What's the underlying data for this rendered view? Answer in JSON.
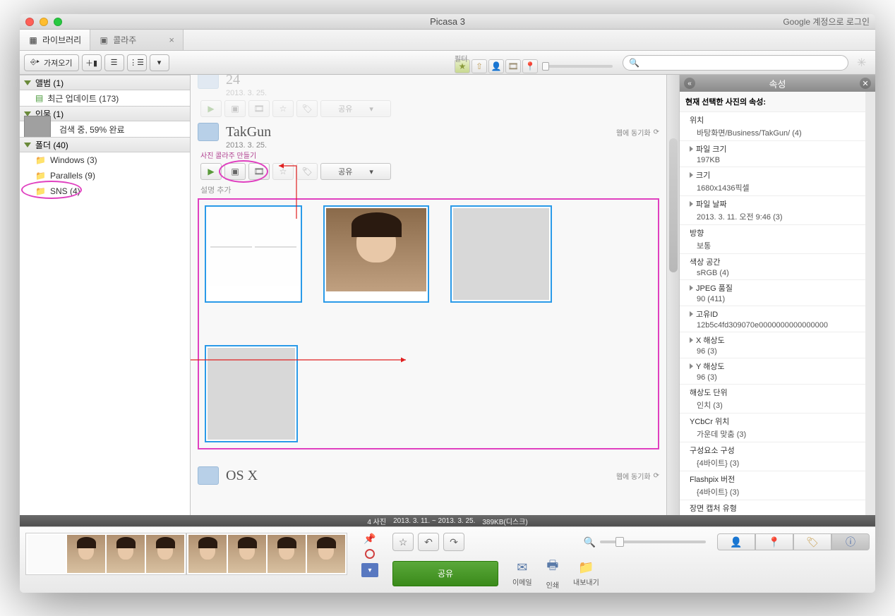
{
  "window": {
    "title": "Picasa 3",
    "login": "Google 계정으로 로그인"
  },
  "tabs": [
    {
      "label": "라이브러리",
      "active": true
    },
    {
      "label": "콜라주",
      "active": false,
      "closable": true
    }
  ],
  "toolbar": {
    "import": "가져오기",
    "filter_label": "필터"
  },
  "sidebar": {
    "albums": {
      "head": "앨범 (1)",
      "items": [
        {
          "label": "최근 업데이트 (173)"
        }
      ]
    },
    "people": {
      "head": "인물 (1)",
      "scan": "검색 중, 59% 완료"
    },
    "folders": {
      "head": "폴더 (40)",
      "items": [
        {
          "label": "Windows (3)"
        },
        {
          "label": "Parallels (9)"
        },
        {
          "label": "SNS (4)",
          "highlighted": true
        }
      ]
    }
  },
  "content": {
    "faded_album": {
      "title": "24",
      "date": "2013. 3. 25."
    },
    "main_album": {
      "title": "TakGun",
      "date": "2013. 3. 25.",
      "overlay_hint": "사진 콜라주 만들기",
      "share": "공유",
      "web_sync": "웹에 동기화",
      "add_desc": "설명 추가",
      "thumbs": [
        {
          "kind": "document"
        },
        {
          "kind": "portrait"
        },
        {
          "kind": "collage4"
        },
        {
          "kind": "collage4"
        }
      ]
    },
    "next_album": {
      "title": "OS X",
      "web_sync": "웹에 동기화"
    }
  },
  "properties": {
    "title": "속성",
    "selected_label": "현재 선택한 사진의 속성:",
    "rows": [
      {
        "k": "위치",
        "v": "바탕화면/Business/TakGun/ (4)",
        "expandable": false
      },
      {
        "k": "파일 크기",
        "v": "197KB",
        "expandable": true
      },
      {
        "k": "크기",
        "v": "1680x1436픽셀",
        "expandable": true
      },
      {
        "k": "파일 날짜",
        "v": "2013. 3. 11. 오전 9:46 (3)",
        "expandable": true
      },
      {
        "k": "방향",
        "v": "보통",
        "expandable": false
      },
      {
        "k": "색상 공간",
        "v": "sRGB (4)",
        "expandable": false
      },
      {
        "k": "JPEG 품질",
        "v": "90 (411)",
        "expandable": true
      },
      {
        "k": "고유ID",
        "v": "12b5c4fd309070e0000000000000000",
        "expandable": true
      },
      {
        "k": "X 해상도",
        "v": "96 (3)",
        "expandable": true
      },
      {
        "k": "Y 해상도",
        "v": "96 (3)",
        "expandable": true
      },
      {
        "k": "해상도 단위",
        "v": "인치 (3)",
        "expandable": false
      },
      {
        "k": "YCbCr 위치",
        "v": "가운데 맞춤 (3)",
        "expandable": false
      },
      {
        "k": "구성요소 구성",
        "v": "{4바이트} (3)",
        "expandable": false
      },
      {
        "k": "Flashpix 버전",
        "v": "{4바이트} (3)",
        "expandable": false
      },
      {
        "k": "장면 캡처 유형",
        "v": "",
        "expandable": false
      }
    ]
  },
  "statusbar": {
    "count": "4 사진",
    "range": "2013. 3. 11. ~ 2013. 3. 25.",
    "size": "389KB(디스크)"
  },
  "bottom": {
    "share": "공유",
    "actions": [
      {
        "icon": "✉",
        "label": "이메일"
      },
      {
        "icon": "🖶",
        "label": "인쇄"
      },
      {
        "icon": "📁",
        "label": "내보내기"
      }
    ]
  }
}
